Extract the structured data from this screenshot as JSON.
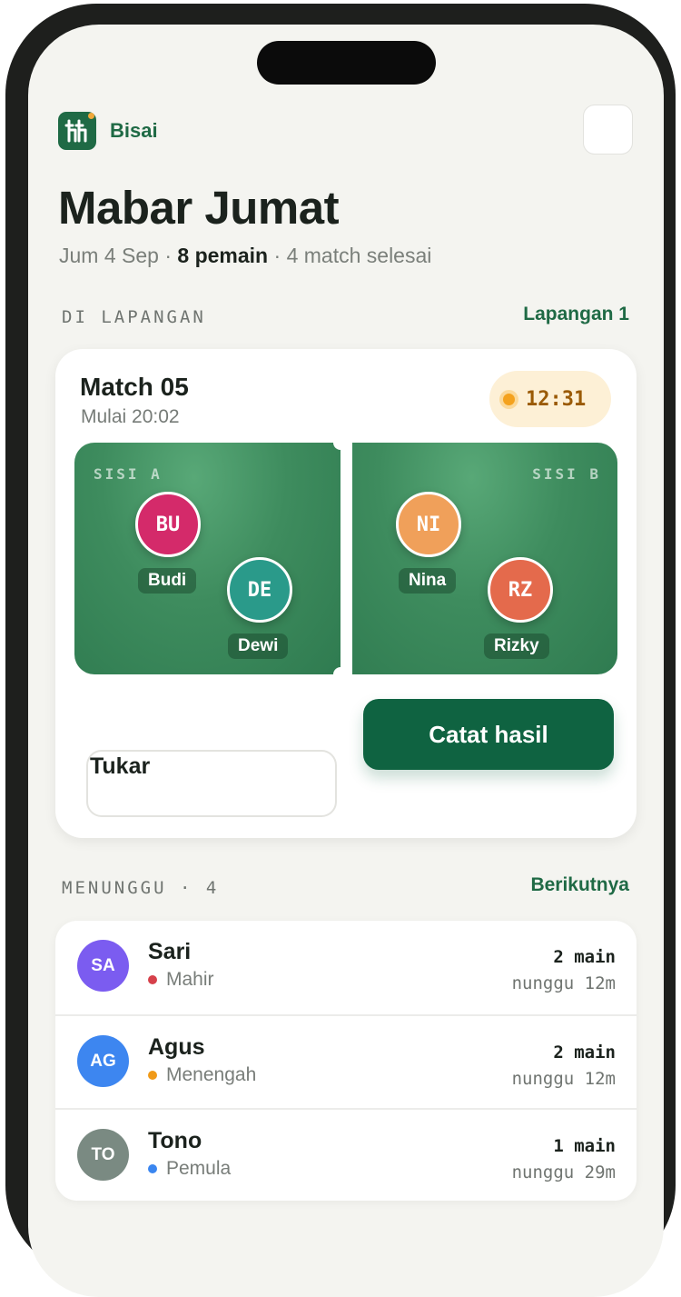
{
  "app": {
    "brand": "Bisai",
    "brand_color": "#1f6a45",
    "logo_icon": "badminton-logo-icon"
  },
  "session": {
    "title": "Mabar Jumat",
    "date": "Jum 4 Sep",
    "players": "8 pemain",
    "matches": "4 match selesai"
  },
  "on_court": {
    "label": "DI LAPANGAN",
    "court_name": "Lapangan 1",
    "match": {
      "title": "Match 05",
      "start": "Mulai 20:02",
      "timer": "12:31",
      "side_a": {
        "label": "SISI A",
        "players": [
          {
            "initials": "BU",
            "name": "Budi",
            "color": "#d42a6a"
          },
          {
            "initials": "DE",
            "name": "Dewi",
            "color": "#2a9a8a"
          }
        ]
      },
      "side_b": {
        "label": "SISI B",
        "players": [
          {
            "initials": "NI",
            "name": "Nina",
            "color": "#f0a05a"
          },
          {
            "initials": "RZ",
            "name": "Rizky",
            "color": "#e46a4c"
          }
        ]
      },
      "swap_label": "Tukar",
      "record_label": "Catat hasil"
    }
  },
  "queue": {
    "label": "MENUNGGU · 4",
    "next_label": "Berikutnya",
    "items": [
      {
        "initials": "SA",
        "name": "Sari",
        "level": "Mahir",
        "level_color": "#d6404a",
        "avatar_color": "#7b5cf0",
        "plays": "2 main",
        "wait": "nunggu 12m"
      },
      {
        "initials": "AG",
        "name": "Agus",
        "level": "Menengah",
        "level_color": "#f09a18",
        "avatar_color": "#3d86f0",
        "plays": "2 main",
        "wait": "nunggu 12m"
      },
      {
        "initials": "TO",
        "name": "Tono",
        "level": "Pemula",
        "level_color": "#3a86f0",
        "avatar_color": "#7a8a82",
        "plays": "1 main",
        "wait": "nunggu 29m"
      }
    ]
  }
}
